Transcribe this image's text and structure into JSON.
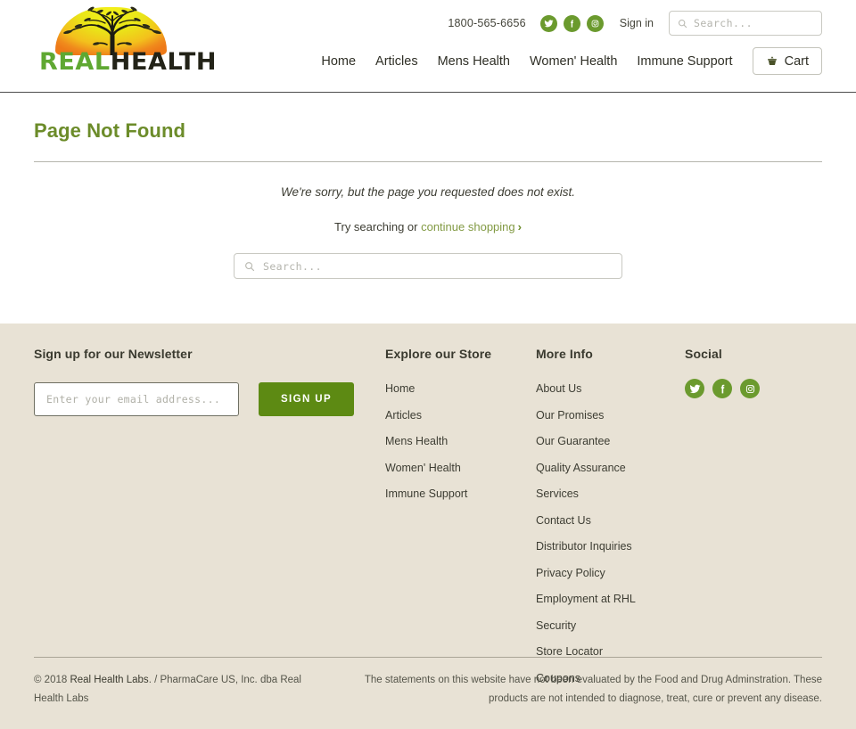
{
  "header": {
    "logo": {
      "word1": "REAL",
      "word2": "HEALTH",
      "icon": "tree-logo"
    },
    "phone": "1800-565-6656",
    "social": [
      {
        "name": "twitter-icon",
        "label": "Twitter"
      },
      {
        "name": "facebook-icon",
        "label": "Facebook"
      },
      {
        "name": "instagram-icon",
        "label": "Instagram"
      }
    ],
    "signin_label": "Sign in",
    "search": {
      "value": "",
      "placeholder": "Search..."
    },
    "nav": [
      {
        "label": "Home"
      },
      {
        "label": "Articles"
      },
      {
        "label": "Mens Health"
      },
      {
        "label": "Women' Health"
      },
      {
        "label": "Immune Support"
      }
    ],
    "cart_label": "Cart"
  },
  "main": {
    "title": "Page Not Found",
    "message": "We're sorry, but the page you requested does not exist.",
    "try_prefix": "Try searching or ",
    "continue_link": "continue shopping",
    "chevron": "›",
    "search": {
      "value": "",
      "placeholder": "Search..."
    }
  },
  "footer": {
    "newsletter": {
      "heading": "Sign up for our Newsletter",
      "input": {
        "value": "",
        "placeholder": "Enter your email address..."
      },
      "button_label": "SIGN UP"
    },
    "explore": {
      "heading": "Explore our Store",
      "links": [
        {
          "label": "Home"
        },
        {
          "label": "Articles"
        },
        {
          "label": "Mens Health"
        },
        {
          "label": "Women' Health"
        },
        {
          "label": "Immune Support"
        }
      ]
    },
    "more_info": {
      "heading": "More Info",
      "links": [
        {
          "label": "About Us"
        },
        {
          "label": "Our Promises"
        },
        {
          "label": "Our Guarantee"
        },
        {
          "label": "Quality Assurance"
        },
        {
          "label": "Services"
        },
        {
          "label": "Contact Us"
        },
        {
          "label": "Distributor Inquiries"
        },
        {
          "label": "Privacy Policy"
        },
        {
          "label": "Employment at RHL"
        },
        {
          "label": "Security"
        },
        {
          "label": "Store Locator"
        },
        {
          "label": "Coupons"
        }
      ]
    },
    "social": {
      "heading": "Social",
      "icons": [
        {
          "name": "twitter-icon",
          "label": "Twitter"
        },
        {
          "name": "facebook-icon",
          "label": "Facebook"
        },
        {
          "name": "instagram-icon",
          "label": "Instagram"
        }
      ]
    },
    "copyright_prefix": "© 2018 ",
    "copyright_link": "Real Health Labs",
    "copyright_suffix": ". / PharmaCare US, Inc. dba Real Health Labs",
    "disclaimer": "The statements on this website have not been evaluated by the Food and Drug Adminstration. These products are not intended to diagnose, treat, cure or prevent any disease."
  },
  "colors": {
    "brand_green": "#6b9a2e",
    "title_green": "#6c8c2a",
    "button_green": "#5d8a13",
    "footer_bg": "#e8e2d5",
    "text": "#3d3d33"
  }
}
